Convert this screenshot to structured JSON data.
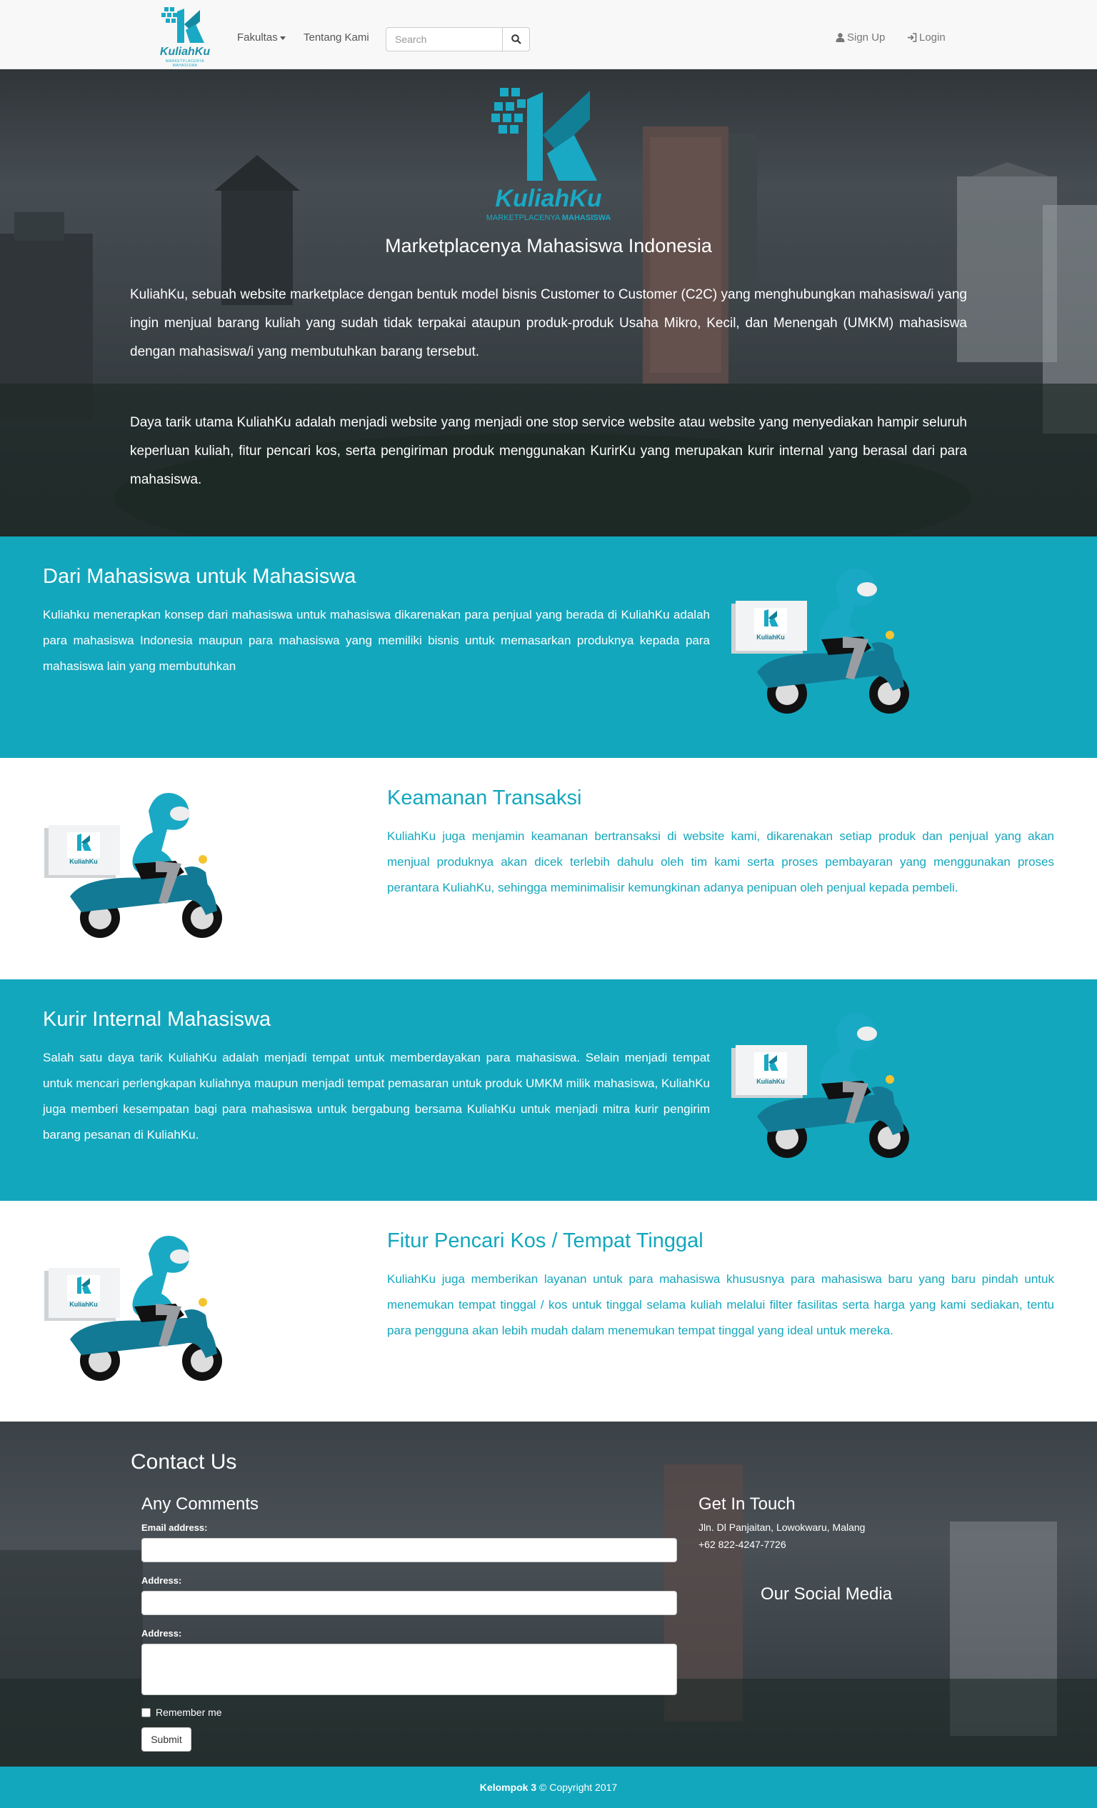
{
  "navbar": {
    "brand_name": "KuliahKu",
    "brand_tagline": "MARKETPLACENYA MAHASISWA",
    "menu": [
      {
        "label": "Fakultas"
      },
      {
        "label": "Tentang Kami"
      }
    ],
    "search": {
      "placeholder": "Search"
    },
    "signup_label": "Sign Up",
    "login_label": "Login"
  },
  "hero": {
    "logo_text": "KuliahKu",
    "logo_sub_1": "MARKETPLACENYA",
    "logo_sub_2": "MAHASISWA",
    "title": "Marketplacenya Mahasiswa Indonesia",
    "paragraphs": [
      "KuliahKu, sebuah website marketplace dengan bentuk model bisnis Customer to Customer (C2C) yang menghubungkan mahasiswa/i yang ingin menjual barang kuliah yang sudah tidak terpakai ataupun produk-produk Usaha Mikro, Kecil, dan Menengah (UMKM) mahasiswa dengan mahasiswa/i yang membutuhkan barang tersebut.",
      "Daya tarik utama KuliahKu adalah menjadi website yang menjadi one stop service website atau website yang menyediakan hampir seluruh keperluan kuliah, fitur pencari kos, serta pengiriman produk menggunakan KurirKu yang merupakan kurir internal yang berasal dari para mahasiswa."
    ]
  },
  "features": [
    {
      "title": "Dari Mahasiswa untuk Mahasiswa",
      "text": "Kuliahku menerapkan konsep dari mahasiswa untuk mahasiswa dikarenakan para penjual yang berada di KuliahKu adalah para mahasiswa Indonesia maupun para mahasiswa yang memiliki bisnis untuk memasarkan produknya kepada para mahasiswa lain yang membutuhkan"
    },
    {
      "title": "Keamanan Transaksi",
      "text": "KuliahKu juga menjamin keamanan bertransaksi di website kami, dikarenakan setiap produk dan penjual yang akan menjual produknya akan dicek terlebih dahulu oleh tim kami serta proses pembayaran yang menggunakan proses perantara KuliahKu, sehingga meminimalisir kemungkinan adanya penipuan oleh penjual kepada pembeli."
    },
    {
      "title": "Kurir Internal Mahasiswa",
      "text": "Salah satu daya tarik KuliahKu adalah menjadi tempat untuk memberdayakan para mahasiswa. Selain menjadi tempat untuk mencari perlengkapan kuliahnya maupun menjadi tempat pemasaran untuk produk UMKM milik mahasiswa, KuliahKu juga memberi kesempatan bagi para mahasiswa untuk bergabung bersama KuliahKu untuk menjadi mitra kurir pengirim barang pesanan di KuliahKu."
    },
    {
      "title": "Fitur Pencari Kos / Tempat Tinggal",
      "text": "KuliahKu juga memberikan layanan untuk para mahasiswa khususnya para mahasiswa baru yang baru pindah untuk menemukan tempat tinggal / kos untuk tinggal selama kuliah melalui filter fasilitas serta harga yang kami sediakan, tentu para pengguna akan lebih mudah dalam menemukan tempat tinggal yang ideal untuk mereka."
    }
  ],
  "scooter_box_label": "KuliahKu",
  "contact": {
    "title": "Contact Us",
    "form_title": "Any Comments",
    "email_label": "Email address:",
    "address_label_1": "Address:",
    "address_label_2": "Address:",
    "remember_label": "Remember me",
    "submit_label": "Submit",
    "touch_title": "Get In Touch",
    "address_line": "Jln. Dl Panjaitan, Lowokwaru, Malang",
    "phone": "+62 822-4247-7726",
    "social_title": "Our Social Media"
  },
  "footer": {
    "group": "Kelompok 3",
    "copyright": "© Copyright 2017"
  },
  "colors": {
    "teal": "#13a7bd",
    "logo_blue": "#1aa9c4",
    "navbar_bg": "#f8f8f8"
  },
  "icons": [
    "search-icon",
    "user-icon",
    "login-icon",
    "caret-down-icon"
  ]
}
